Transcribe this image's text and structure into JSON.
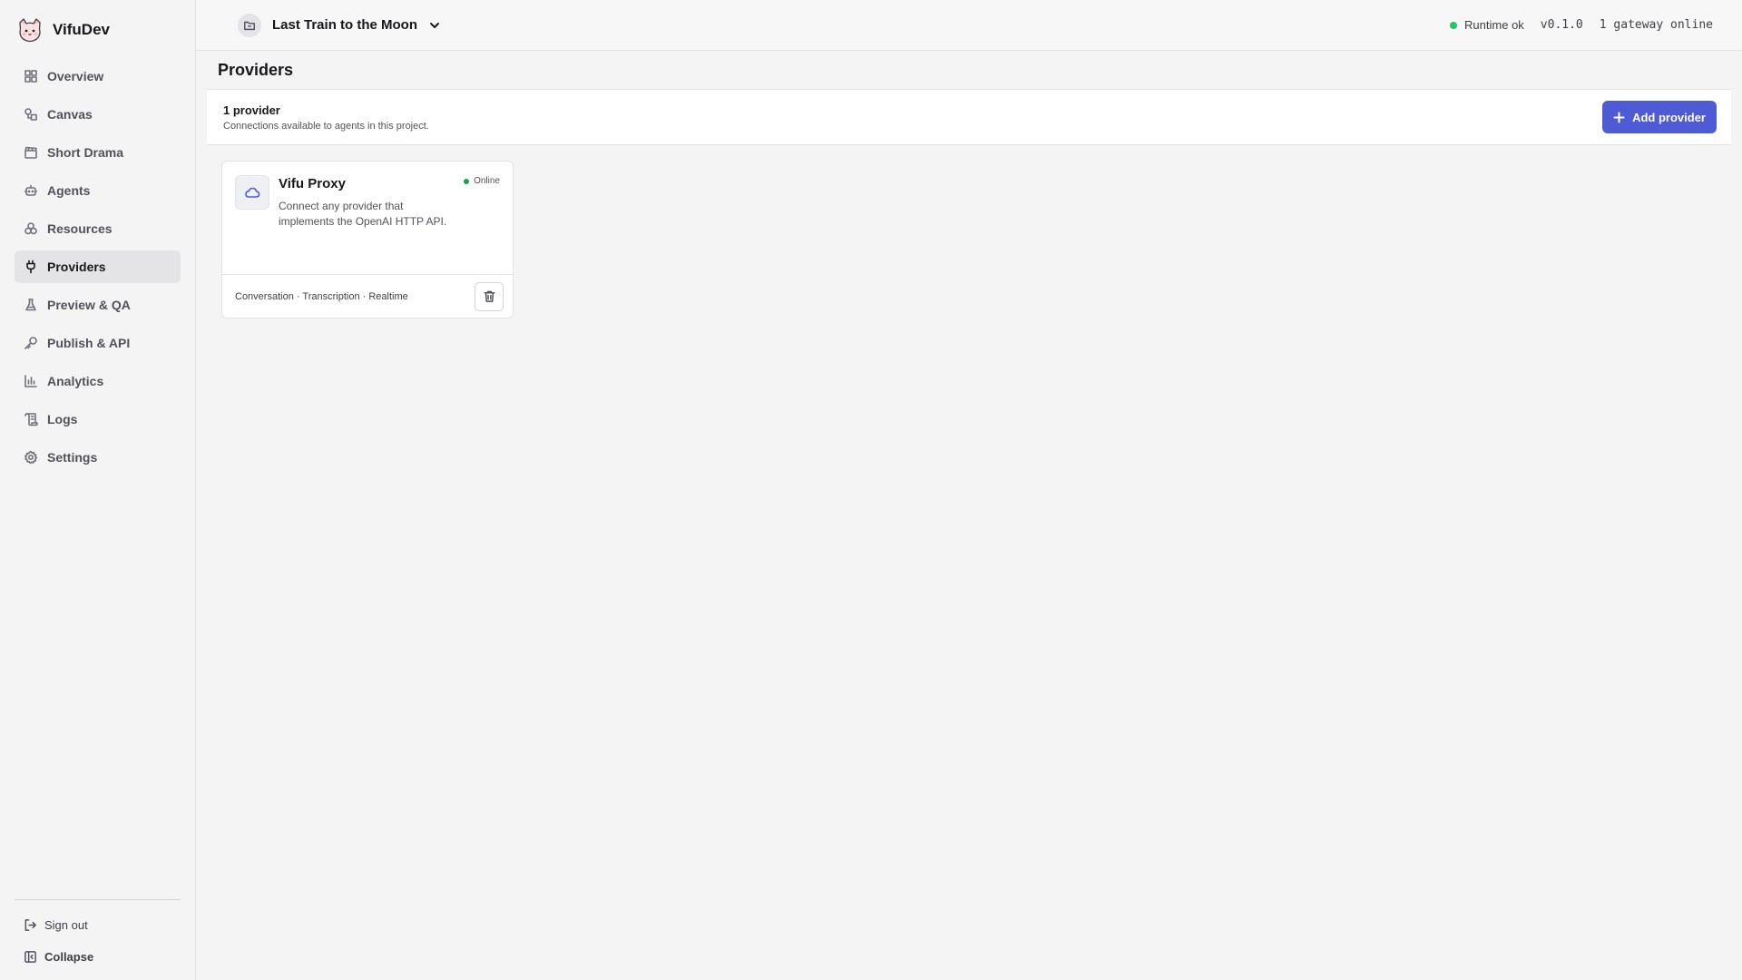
{
  "app": {
    "name": "VifuDev"
  },
  "sidebar": {
    "items": [
      {
        "label": "Overview",
        "icon": "layout-grid-icon"
      },
      {
        "label": "Canvas",
        "icon": "shapes-icon"
      },
      {
        "label": "Short Drama",
        "icon": "clapperboard-icon"
      },
      {
        "label": "Agents",
        "icon": "bot-icon"
      },
      {
        "label": "Resources",
        "icon": "boxes-icon"
      },
      {
        "label": "Providers",
        "icon": "plug-icon",
        "active": true
      },
      {
        "label": "Preview & QA",
        "icon": "flask-icon"
      },
      {
        "label": "Publish & API",
        "icon": "key-icon"
      },
      {
        "label": "Analytics",
        "icon": "bar-chart-icon"
      },
      {
        "label": "Logs",
        "icon": "scroll-icon"
      },
      {
        "label": "Settings",
        "icon": "gear-icon"
      }
    ],
    "sign_out": "Sign out",
    "collapse": "Collapse"
  },
  "topbar": {
    "project_name": "Last Train to the Moon",
    "runtime_status": "Runtime ok",
    "version": "v0.1.0",
    "gateways": "1 gateway online",
    "status_color": "#22c55e"
  },
  "page": {
    "title": "Providers",
    "count": "1 provider",
    "description": "Connections available to agents in this project.",
    "add_button": "Add provider"
  },
  "providers": [
    {
      "name": "Vifu Proxy",
      "status": "Online",
      "description": "Connect any provider that implements the OpenAI HTTP API.",
      "capabilities": "Conversation · Transcription · Realtime",
      "icon": "cloud-icon"
    }
  ],
  "colors": {
    "accent": "#4f5bd5",
    "online": "#16a34a"
  }
}
